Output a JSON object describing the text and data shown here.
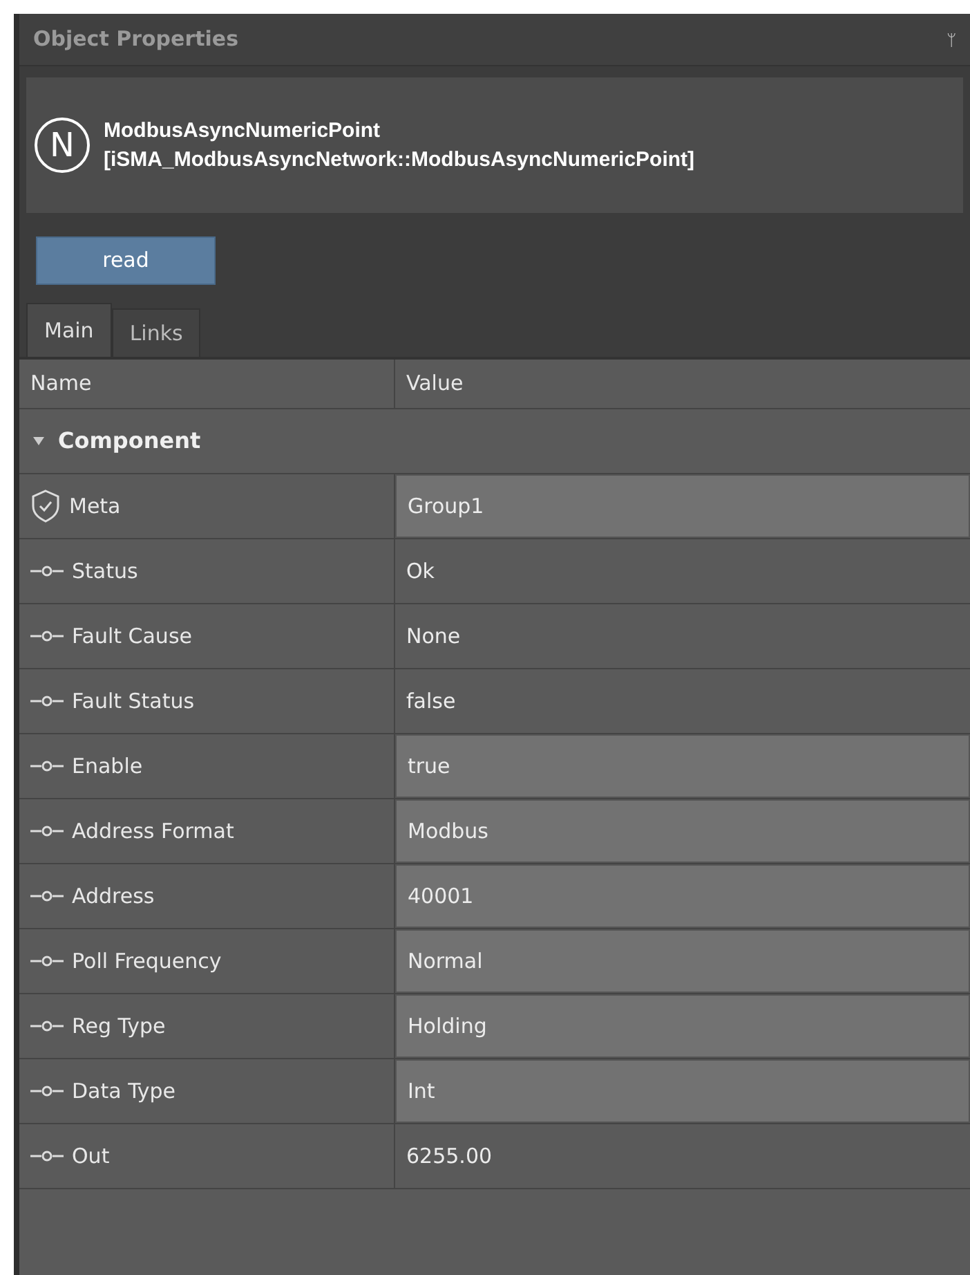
{
  "panel": {
    "title": "Object Properties",
    "pin": "ᛘ"
  },
  "header": {
    "name": "ModbusAsyncNumericPoint",
    "type": "[iSMA_ModbusAsyncNetwork::ModbusAsyncNumericPoint]",
    "badge": "N"
  },
  "actions": [
    "read"
  ],
  "tabs": [
    {
      "label": "Main",
      "selected": true
    },
    {
      "label": "Links",
      "selected": false
    }
  ],
  "table": {
    "columns": [
      "Name",
      "Value"
    ],
    "group": {
      "label": "Component",
      "expanded": true
    },
    "rows": [
      {
        "kind": "meta",
        "name": "Meta",
        "value": "Group1",
        "editable": true
      },
      {
        "kind": "slot",
        "name": "Status",
        "value": "Ok",
        "editable": false
      },
      {
        "kind": "slot",
        "name": "Fault Cause",
        "value": "None",
        "editable": false
      },
      {
        "kind": "slot",
        "name": "Fault Status",
        "value": "false",
        "editable": false
      },
      {
        "kind": "slot",
        "name": "Enable",
        "value": "true",
        "editable": true
      },
      {
        "kind": "slot",
        "name": "Address Format",
        "value": "Modbus",
        "editable": true
      },
      {
        "kind": "slot",
        "name": "Address",
        "value": "40001",
        "editable": true
      },
      {
        "kind": "slot",
        "name": "Poll Frequency",
        "value": "Normal",
        "editable": true
      },
      {
        "kind": "slot",
        "name": "Reg Type",
        "value": "Holding",
        "editable": true
      },
      {
        "kind": "slot",
        "name": "Data Type",
        "value": "Int",
        "editable": true
      },
      {
        "kind": "slot",
        "name": "Out",
        "value": "6255.00",
        "editable": false
      }
    ]
  }
}
